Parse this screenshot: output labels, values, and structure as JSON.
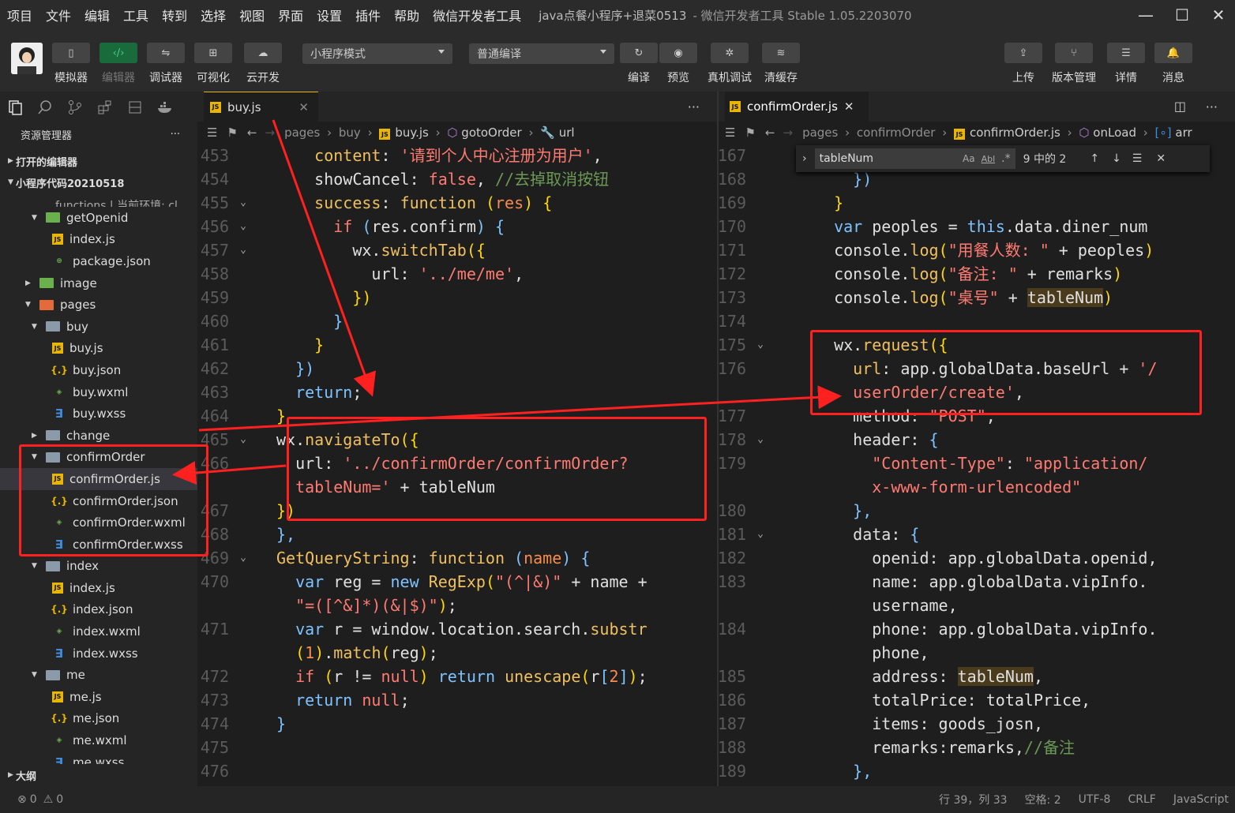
{
  "menu": {
    "items": [
      "项目",
      "文件",
      "编辑",
      "工具",
      "转到",
      "选择",
      "视图",
      "界面",
      "设置",
      "插件",
      "帮助",
      "微信开发者工具"
    ],
    "window_title": "java点餐小程序+退菜0513",
    "app_title": "- 微信开发者工具 Stable 1.05.2203070"
  },
  "toolbar": {
    "left_buttons": [
      "模拟器",
      "编辑器",
      "调试器",
      "可视化",
      "云开发"
    ],
    "mode_select": "小程序模式",
    "compile_select": "普通编译",
    "mid_buttons": [
      "编译",
      "预览",
      "真机调试",
      "清缓存"
    ],
    "right_buttons": [
      "上传",
      "版本管理",
      "详情",
      "消息"
    ]
  },
  "sidebar": {
    "title": "资源管理器",
    "more": "···",
    "open_editors": "打开的编辑器",
    "project": "小程序代码20210518",
    "partial_row": "functions | 当前环境: cl...",
    "outline": "大纲",
    "tree": [
      {
        "name": "getOpenid",
        "type": "folder-green",
        "level": 1,
        "open": true
      },
      {
        "name": "index.js",
        "type": "js",
        "level": 2
      },
      {
        "name": "package.json",
        "type": "pkg",
        "level": 2
      },
      {
        "name": "image",
        "type": "folder-img",
        "level": 0,
        "open": false
      },
      {
        "name": "pages",
        "type": "folder-orange",
        "level": 0,
        "open": true
      },
      {
        "name": "buy",
        "type": "folder",
        "level": 1,
        "open": true
      },
      {
        "name": "buy.js",
        "type": "js",
        "level": 2
      },
      {
        "name": "buy.json",
        "type": "json",
        "level": 2
      },
      {
        "name": "buy.wxml",
        "type": "wxml",
        "level": 2
      },
      {
        "name": "buy.wxss",
        "type": "wxss",
        "level": 2
      },
      {
        "name": "change",
        "type": "folder",
        "level": 1,
        "open": false
      },
      {
        "name": "confirmOrder",
        "type": "folder",
        "level": 1,
        "open": true
      },
      {
        "name": "confirmOrder.js",
        "type": "js",
        "level": 2,
        "selected": true
      },
      {
        "name": "confirmOrder.json",
        "type": "json",
        "level": 2
      },
      {
        "name": "confirmOrder.wxml",
        "type": "wxml",
        "level": 2
      },
      {
        "name": "confirmOrder.wxss",
        "type": "wxss",
        "level": 2
      },
      {
        "name": "index",
        "type": "folder",
        "level": 1,
        "open": true
      },
      {
        "name": "index.js",
        "type": "js",
        "level": 2
      },
      {
        "name": "index.json",
        "type": "json",
        "level": 2
      },
      {
        "name": "index.wxml",
        "type": "wxml",
        "level": 2
      },
      {
        "name": "index.wxss",
        "type": "wxss",
        "level": 2
      },
      {
        "name": "me",
        "type": "folder",
        "level": 1,
        "open": true
      },
      {
        "name": "me.js",
        "type": "js",
        "level": 2
      },
      {
        "name": "me.json",
        "type": "json",
        "level": 2
      },
      {
        "name": "me.wxml",
        "type": "wxml",
        "level": 2
      },
      {
        "name": "me.wxss",
        "type": "wxss",
        "level": 2
      }
    ]
  },
  "editor_left": {
    "tab": "buy.js",
    "breadcrumb": [
      "pages",
      "buy",
      "buy.js",
      "gotoOrder",
      "url"
    ],
    "line_numbers": [
      "453",
      "454",
      "455",
      "456",
      "457",
      "458",
      "459",
      "460",
      "461",
      "462",
      "463",
      "464",
      "465",
      "466",
      "",
      "467",
      "468",
      "469",
      "470",
      "",
      "471",
      "",
      "472",
      "473",
      "474",
      "475",
      "476"
    ]
  },
  "editor_right": {
    "tab": "confirmOrder.js",
    "breadcrumb": [
      "pages",
      "confirmOrder",
      "confirmOrder.js",
      "onLoad",
      "arr"
    ],
    "find": {
      "query": "tableNum",
      "count": "9 中的 2",
      "aa": "Aa",
      "ab": "Abl"
    },
    "line_numbers": [
      "167",
      "168",
      "169",
      "170",
      "171",
      "172",
      "173",
      "174",
      "175",
      "176",
      "",
      "177",
      "178",
      "179",
      "",
      "180",
      "181",
      "182",
      "183",
      "",
      "184",
      "",
      "185",
      "186",
      "187",
      "188",
      "189"
    ]
  },
  "status": {
    "errors": "0",
    "warnings": "0",
    "position": "行 39，列 33",
    "indent": "空格: 2",
    "encoding": "UTF-8",
    "eol": "CRLF",
    "language": "JavaScript"
  },
  "colors": {
    "accent_red": "#ff2020",
    "keyword": "#ff7b72",
    "function": "#f0c060"
  }
}
